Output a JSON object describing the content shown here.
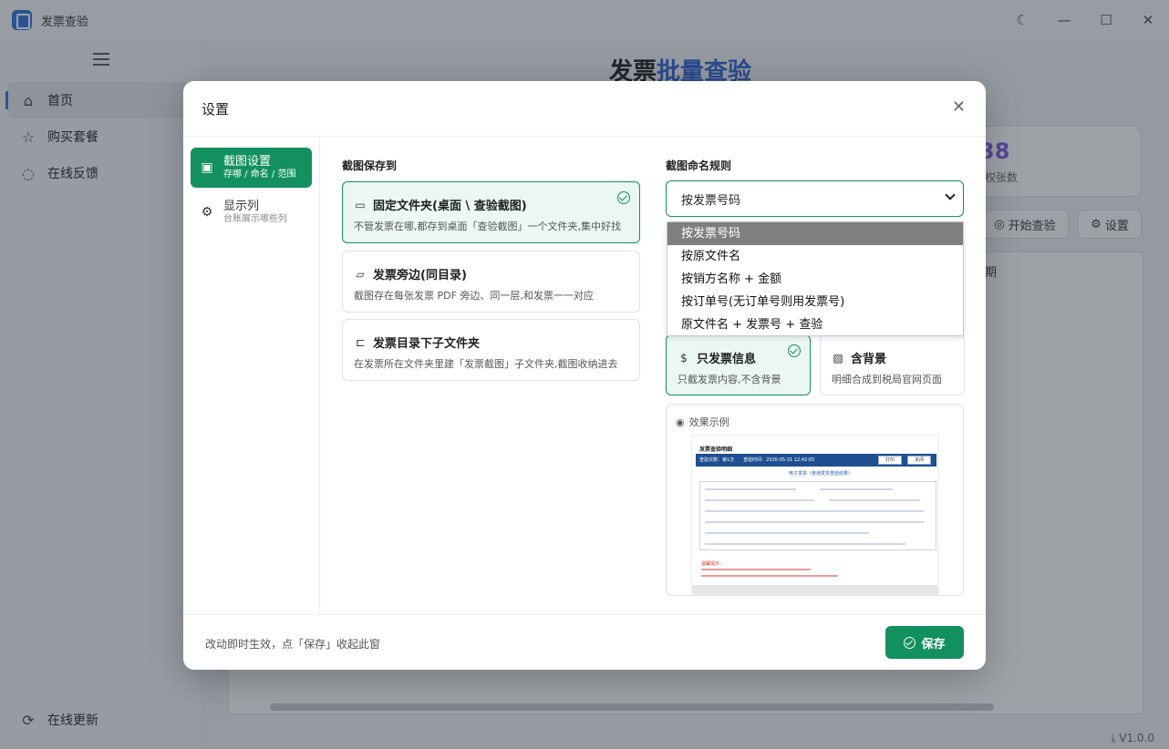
{
  "window": {
    "title": "发票查验",
    "controls": {
      "theme": "☾",
      "minimize": "—",
      "maximize": "☐",
      "close": "✕"
    }
  },
  "sidebar": {
    "items": [
      {
        "label": "首页",
        "icon": "home-icon",
        "glyph": "⌂",
        "active": true
      },
      {
        "label": "购买套餐",
        "icon": "star-icon",
        "glyph": "☆",
        "active": false
      },
      {
        "label": "在线反馈",
        "icon": "chat-bubble-icon",
        "glyph": "◌",
        "active": false
      }
    ],
    "bottom_item": {
      "label": "在线更新",
      "icon": "refresh-icon",
      "glyph": "⟳"
    }
  },
  "main": {
    "heading_prefix": "发票",
    "heading_accent": "批量查验",
    "stat_value": "38",
    "stat_label": "权张数",
    "start_check_label": "开始查验",
    "settings_label": "设置",
    "table_column": "期",
    "version": "V1.0.0"
  },
  "modal": {
    "title": "设置",
    "close": "✕",
    "tabs": [
      {
        "title": "截图设置",
        "subtitle": "存哪 / 命名 / 范围",
        "icon": "image-icon",
        "glyph": "▣",
        "active": true
      },
      {
        "title": "显示列",
        "subtitle": "台账展示哪些列",
        "icon": "gear-icon",
        "glyph": "⚙",
        "active": false
      }
    ],
    "save_to": {
      "label": "截图保存到",
      "options": [
        {
          "title": "固定文件夹(桌面 \\ 查验截图)",
          "desc": "不管发票在哪,都存到桌面「查验截图」一个文件夹,集中好找",
          "icon": "folder-icon",
          "glyph": "▭",
          "selected": true
        },
        {
          "title": "发票旁边(同目录)",
          "desc": "截图存在每张发票 PDF 旁边、同一层,和发票一一对应",
          "icon": "folder-open-icon",
          "glyph": "▱",
          "selected": false
        },
        {
          "title": "发票目录下子文件夹",
          "desc": "在发票所在文件夹里建「发票截图」子文件夹,截图收纳进去",
          "icon": "folder-tree-icon",
          "glyph": "⊏",
          "selected": false
        }
      ]
    },
    "naming": {
      "label": "截图命名规则",
      "selected": "按发票号码",
      "options": [
        "按发票号码",
        "按原文件名",
        "按销方名称 + 金额",
        "按订单号(无订单号则用发票号)",
        "原文件名 + 发票号 + 查验"
      ]
    },
    "modes": [
      {
        "title": "只发票信息",
        "desc": "只截发票内容,不含背景",
        "icon": "dollar-doc-icon",
        "glyph": "$",
        "selected": true
      },
      {
        "title": "含背景",
        "desc": "明细合成到税局官网页面",
        "icon": "picture-icon",
        "glyph": "▨",
        "selected": false
      }
    ],
    "preview": {
      "label": "效果示例",
      "doc_title": "发票查验明细",
      "bar_text": "查验次数：第1次　　查验时间：2026-05-31 12:42:05",
      "print_btn": "打印",
      "close_btn": "关闭",
      "subtitle": "电子发票（普通发票查验结果）",
      "note": "温馨提示："
    },
    "footer_note": "改动即时生效，点「保存」收起此窗",
    "save_label": "保存"
  }
}
